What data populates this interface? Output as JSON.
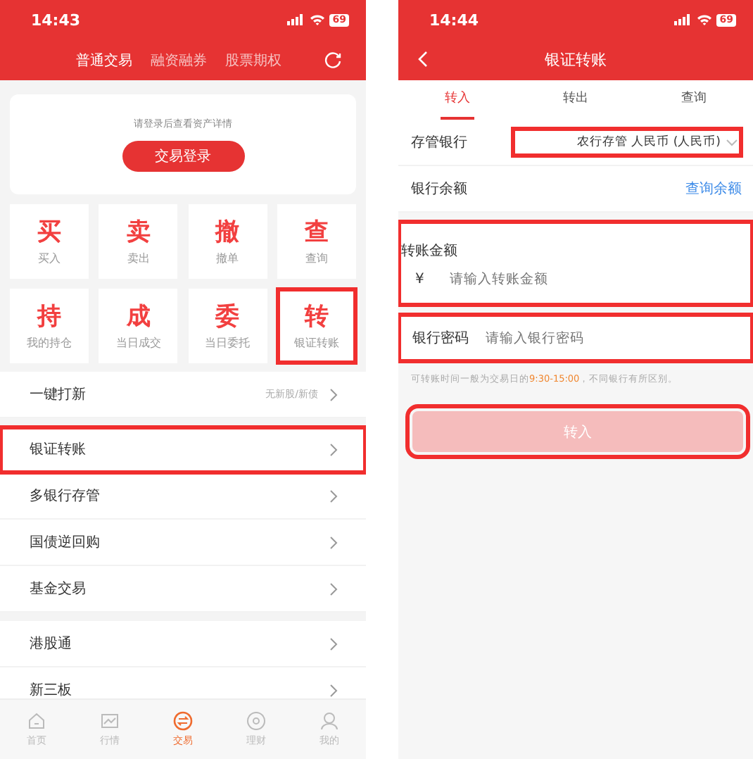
{
  "left_screen": {
    "status_bar": {
      "time": "14:43",
      "battery": "69"
    },
    "market_tabs": [
      {
        "label": "普通交易",
        "selected": true
      },
      {
        "label": "融资融券",
        "selected": false
      },
      {
        "label": "股票期权",
        "selected": false
      }
    ],
    "login_card": {
      "prompt": "请登录后查看资产详情",
      "button": "交易登录"
    },
    "quick_actions": [
      {
        "glyph": "买",
        "label": "买入",
        "highlighted": false
      },
      {
        "glyph": "卖",
        "label": "卖出",
        "highlighted": false
      },
      {
        "glyph": "撤",
        "label": "撤单",
        "highlighted": false
      },
      {
        "glyph": "查",
        "label": "查询",
        "highlighted": false
      },
      {
        "glyph": "持",
        "label": "我的持仓",
        "highlighted": false
      },
      {
        "glyph": "成",
        "label": "当日成交",
        "highlighted": false
      },
      {
        "glyph": "委",
        "label": "当日委托",
        "highlighted": false
      },
      {
        "glyph": "转",
        "label": "银证转账",
        "highlighted": true
      }
    ],
    "menu_groups": [
      [
        {
          "label": "一键打新",
          "note": "无新股/新债",
          "highlighted": false
        }
      ],
      [
        {
          "label": "银证转账",
          "highlighted": true
        },
        {
          "label": "多银行存管",
          "highlighted": false
        },
        {
          "label": "国债逆回购",
          "highlighted": false
        },
        {
          "label": "基金交易",
          "highlighted": false
        }
      ],
      [
        {
          "label": "港股通",
          "highlighted": false
        },
        {
          "label": "新三板",
          "highlighted": false
        }
      ]
    ],
    "bottom_nav": [
      {
        "kind": "home",
        "label": "首页",
        "selected": false
      },
      {
        "kind": "market",
        "label": "行情",
        "selected": false
      },
      {
        "kind": "trade",
        "label": "交易",
        "selected": true
      },
      {
        "kind": "wealth",
        "label": "理财",
        "selected": false
      },
      {
        "kind": "me",
        "label": "我的",
        "selected": false
      }
    ]
  },
  "right_screen": {
    "status_bar": {
      "time": "14:44",
      "battery": "69"
    },
    "title": "银证转账",
    "tabs": [
      {
        "label": "转入",
        "selected": true
      },
      {
        "label": "转出",
        "selected": false
      },
      {
        "label": "查询",
        "selected": false
      }
    ],
    "custody_bank": {
      "label": "存管银行",
      "value": "农行存管 人民币 (人民币)",
      "highlighted": true
    },
    "balance": {
      "label": "银行余额",
      "link": "查询余额"
    },
    "amount": {
      "label": "转账金额",
      "currency": "¥",
      "placeholder": "请输入转账金额",
      "highlighted": true
    },
    "password": {
      "label": "银行密码",
      "placeholder": "请输入银行密码",
      "highlighted": true
    },
    "note": {
      "before": "可转账时间一般为交易日的",
      "time": "9:30-15:00",
      "after": "，不同银行有所区别。"
    },
    "submit": {
      "label": "转入",
      "disabled": true,
      "highlighted": true
    }
  }
}
